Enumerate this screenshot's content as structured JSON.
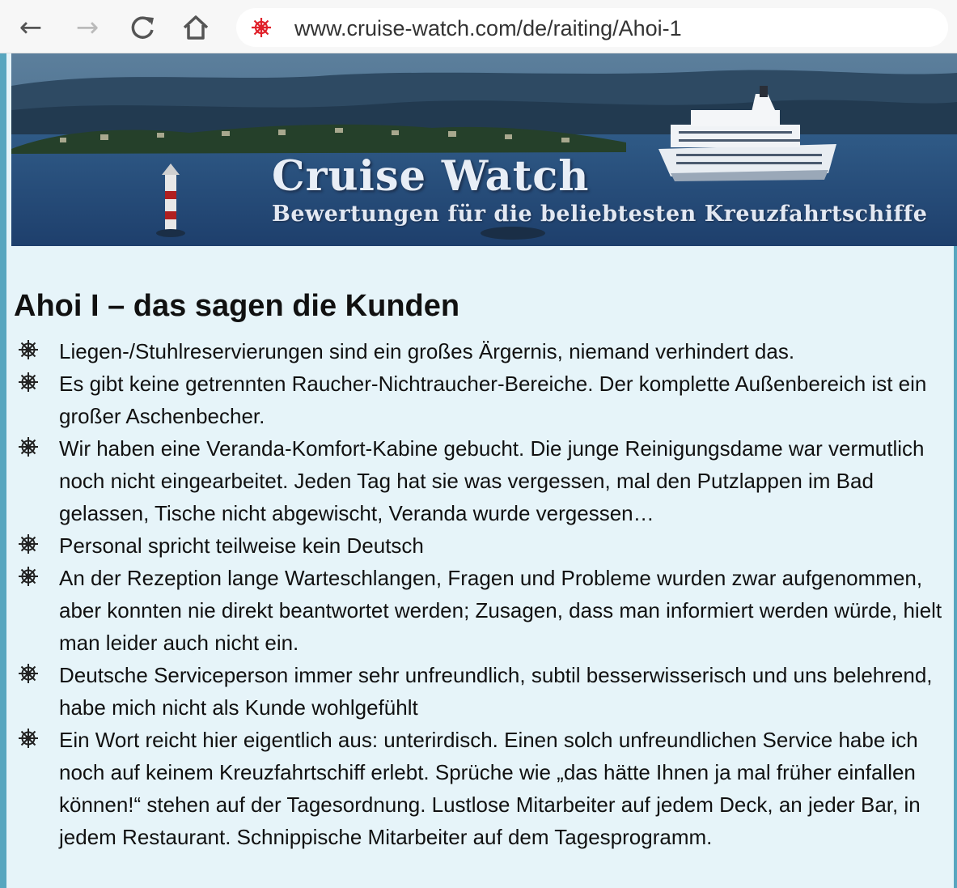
{
  "browser": {
    "url": "www.cruise-watch.com/de/raiting/Ahoi-1",
    "icons": [
      "back-arrow-icon",
      "forward-arrow-icon",
      "reload-icon",
      "home-icon",
      "site-favicon"
    ],
    "back_glyph": "←",
    "forward_glyph": "→",
    "reload_glyph": "C",
    "home_glyph": "⌂"
  },
  "banner": {
    "title": "Cruise Watch",
    "subtitle": "Bewertungen für die beliebtesten Kreuzfahrtschiffe"
  },
  "main": {
    "heading": "Ahoi I – das sagen die Kunden",
    "reviews": [
      "Liegen-/Stuhlreservierungen sind ein großes Ärgernis, niemand verhindert das.",
      "Es gibt keine getrennten Raucher-Nichtraucher-Bereiche. Der komplette Außenbereich ist ein großer Aschenbecher.",
      "Wir haben eine Veranda-Komfort-Kabine gebucht. Die junge Reinigungsdame war vermutlich noch nicht eingearbeitet. Jeden Tag hat sie was vergessen, mal den Putzlappen im Bad gelassen, Tische nicht abgewischt, Veranda wurde vergessen…",
      "Personal spricht teilweise kein Deutsch",
      "An der Rezeption lange Warteschlangen, Fragen und Probleme wurden zwar aufgenommen, aber konnten nie direkt beantwortet werden; Zusagen, dass man informiert werden würde, hielt man leider auch nicht ein.",
      "Deutsche Serviceperson immer sehr unfreundlich, subtil besserwisserisch und uns belehrend, habe mich nicht als Kunde wohlgefühlt",
      "Ein Wort reicht hier eigentlich aus: unterirdisch. Einen solch unfreundlichen Service habe ich noch auf keinem Kreuzfahrtschiff erlebt. Sprüche wie „das hätte Ihnen ja mal früher einfallen können!“ stehen auf der Tagesordnung. Lustlose Mitarbeiter auf jedem Deck, an jeder Bar, in jedem Restaurant. Schnippische Mitarbeiter auf dem Tagesprogramm."
    ],
    "bullet_icon": "ship-wheel-icon"
  },
  "colors": {
    "page_background": "#e6f4f9",
    "frame_border": "#58a6bf",
    "favicon_red": "#e0202a",
    "text": "#111111"
  }
}
